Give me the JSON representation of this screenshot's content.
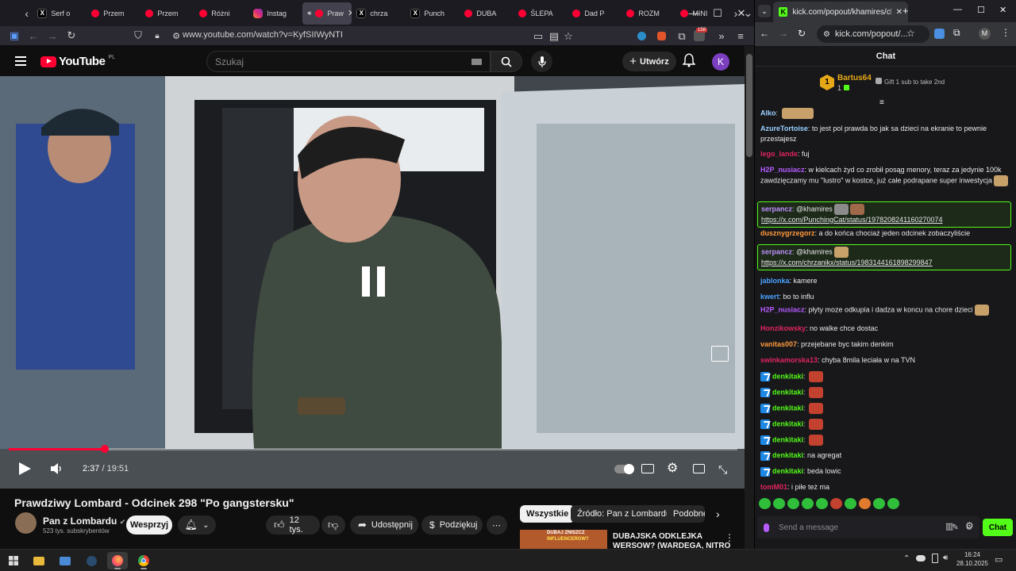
{
  "firefox": {
    "tabs": [
      {
        "label": "Serf o",
        "icon": "x-icon"
      },
      {
        "label": "Przem",
        "icon": "youtube-icon"
      },
      {
        "label": "Przem",
        "icon": "youtube-icon"
      },
      {
        "label": "Różni",
        "icon": "youtube-icon"
      },
      {
        "label": "Instag",
        "icon": "instagram-icon"
      },
      {
        "label": "Praw",
        "icon": "youtube-icon",
        "active": true
      },
      {
        "label": "chrza",
        "icon": "x-icon"
      },
      {
        "label": "Punch",
        "icon": "x-icon"
      },
      {
        "label": "DUBA",
        "icon": "youtube-icon"
      },
      {
        "label": "ŚLEPA",
        "icon": "youtube-icon"
      },
      {
        "label": "Dad P",
        "icon": "youtube-icon"
      },
      {
        "label": "ROZM",
        "icon": "youtube-icon"
      },
      {
        "label": "MINI",
        "icon": "youtube-icon"
      }
    ],
    "url": "www.youtube.com/watch?v=KyfSIIWyNTI",
    "extension_badge": "158"
  },
  "youtube": {
    "logo_text": "YouTube",
    "logo_region": "PL",
    "search_placeholder": "Szukaj",
    "create_label": "Utwórz",
    "avatar_letter": "K",
    "player": {
      "current_time": "2:37",
      "duration": "19:51",
      "progress": 0.132
    },
    "video_title": "Prawdziwy Lombard - Odcinek 298 \"Po gangstersku\"",
    "channel_name": "Pan z Lombardu",
    "subscribers": "523 tys. subskrybentów",
    "support_label": "Wesprzyj",
    "likes": "12 tys.",
    "share_label": "Udostępnij",
    "thanks_label": "Podziękuj",
    "chips": [
      "Wszystkie",
      "Źródło: Pan z Lombardu",
      "Podobne"
    ],
    "recommended": {
      "title_line1": "DUBAJSKA ODKLEJKA",
      "title_line2": "WERSOW? (WARDEGA, NITRO",
      "thumb_text_1": "DUBAJ ZNISZCZ",
      "thumb_text_2": "INFLUENCEROW?"
    }
  },
  "chrome": {
    "tab_title": "kick.com/popout/khamires/chat",
    "omnibox": "kick.com/popout/...",
    "profile_letter": "M"
  },
  "kick": {
    "header": "Chat",
    "pinned": {
      "rank": "1",
      "user": "Bartus64",
      "count": "1",
      "gift_text": "Gift 1 sub to take 2nd"
    },
    "messages": [
      {
        "user": "Alko",
        "color": "#9ad0ff",
        "text": "",
        "emotes": 1
      },
      {
        "user": "AzureTortoise",
        "color": "#9ad0ff",
        "text": "to jest pol prawda bo jak sa dzieci na ekranie to pewnie przestajesz"
      },
      {
        "user": "lego_lande",
        "color": "#e0245e",
        "text": "fuj"
      },
      {
        "user": "H2P_nusiacz",
        "color": "#b65cff",
        "text": "w kielcach żyd co zrobił posąg menory, teraz za jedynie 100k zawdzięczamy mu \"lustro\" w kostce, już całe podrapane super inwestycja",
        "emotes": 1
      },
      {
        "user": "serpancz",
        "color": "#c090ff",
        "text": "@khamires",
        "link": "https://x.com/PunchingCat/status/1978208241160270074",
        "emotes": 2,
        "highlight": true
      },
      {
        "user": "dusznygrzegorz",
        "color": "#ff9a3c",
        "text": "a do końca chociaż jeden odcinek zobaczyliście"
      },
      {
        "user": "serpancz",
        "color": "#c090ff",
        "text": "@khamires",
        "link": "https://x.com/chrzanikx/status/1983144161898299847",
        "emotes": 1,
        "highlight": true
      },
      {
        "user": "jablonka",
        "color": "#4aa3ff",
        "text": "kamere"
      },
      {
        "user": "kwert",
        "color": "#4aa3ff",
        "text": "bo to influ"
      },
      {
        "user": "H2P_nusiacz",
        "color": "#b65cff",
        "text": "płyty moze odkupia i dadza w koncu na chore dzieci",
        "emotes": 1
      },
      {
        "user": "Honzikowsky",
        "color": "#e0245e",
        "text": "no walke chce dostac"
      },
      {
        "user": "vanitas007",
        "color": "#ff9a3c",
        "text": "przejebane byc takim denkim"
      },
      {
        "user": "swinkamorska13",
        "color": "#e0245e",
        "text": "chyba 8mila leciała w na TVN"
      },
      {
        "user": "denkitaki",
        "color": "#53fc18",
        "text": "",
        "emotes": 1,
        "badge": true
      },
      {
        "user": "denkitaki",
        "color": "#53fc18",
        "text": "",
        "emotes": 1,
        "badge": true
      },
      {
        "user": "denkitaki",
        "color": "#53fc18",
        "text": "",
        "emotes": 1,
        "badge": true
      },
      {
        "user": "denkitaki",
        "color": "#53fc18",
        "text": "",
        "emotes": 1,
        "badge": true
      },
      {
        "user": "denkitaki",
        "color": "#53fc18",
        "text": "",
        "emotes": 1,
        "badge": true
      },
      {
        "user": "denkitaki",
        "color": "#53fc18",
        "text": "na agregat",
        "badge": true
      },
      {
        "user": "denkitaki",
        "color": "#53fc18",
        "text": "beda lowic",
        "badge": true
      },
      {
        "user": "tomM01",
        "color": "#e0245e",
        "text": "i piłe też ma"
      }
    ],
    "input_placeholder": "Send a message",
    "send_label": "Chat"
  },
  "taskbar": {
    "time": "16:24",
    "date": "28.10.2025"
  }
}
